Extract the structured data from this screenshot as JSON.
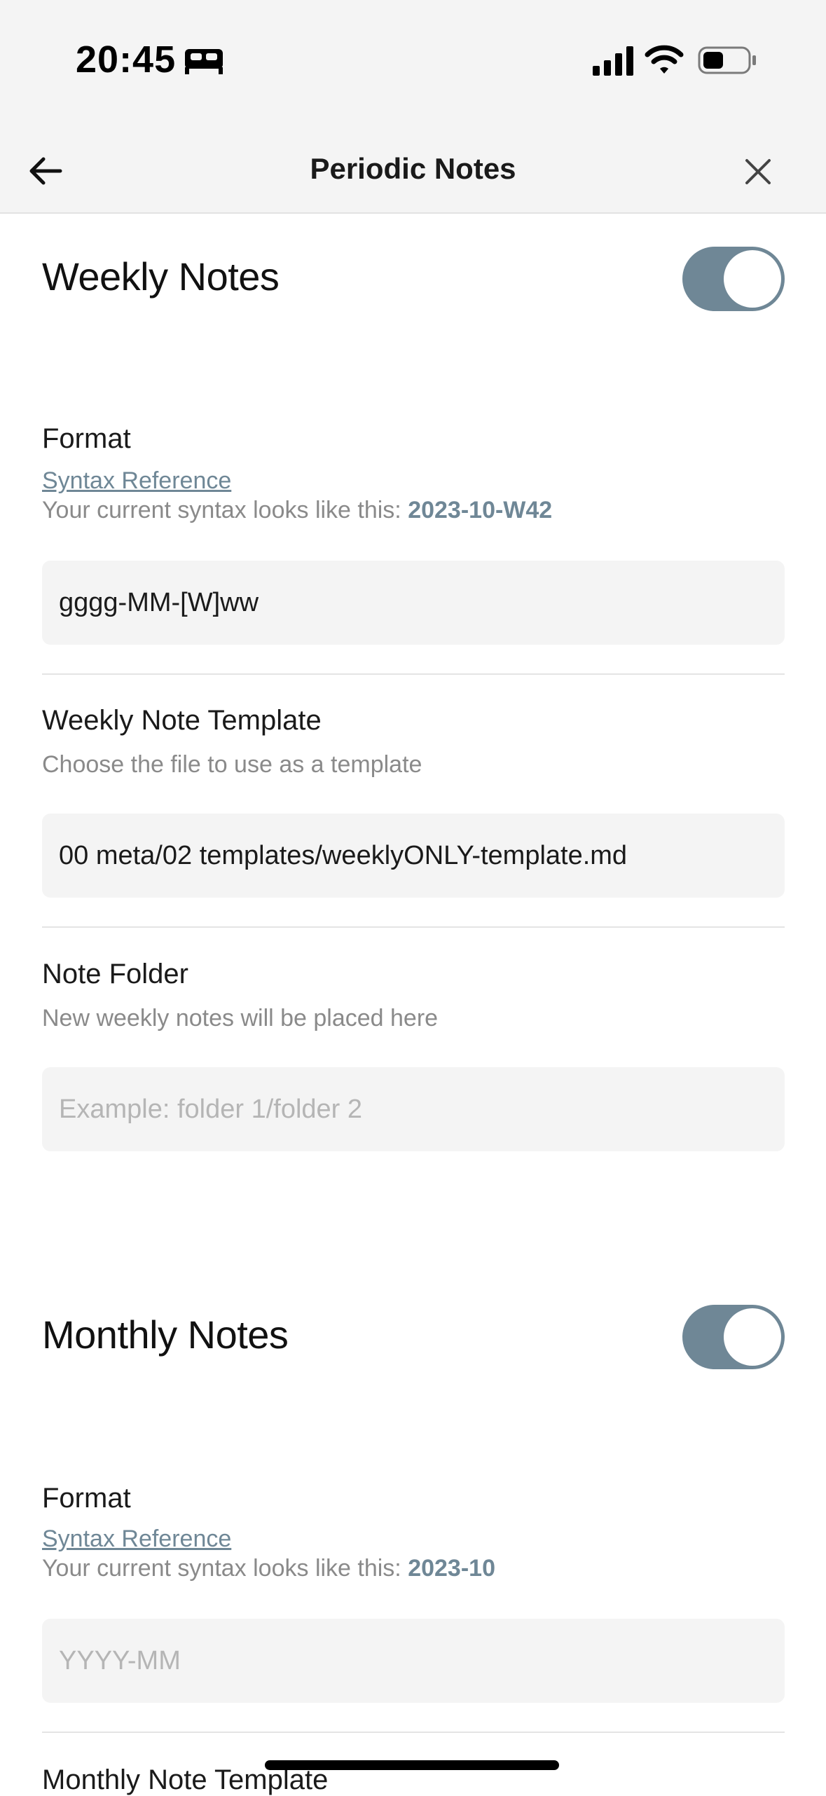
{
  "status_bar": {
    "time": "20:45",
    "icons": [
      "bed-icon",
      "signal-icon",
      "wifi-icon",
      "battery-icon"
    ]
  },
  "nav": {
    "title": "Periodic Notes",
    "back_icon": "arrow-left",
    "close_icon": "x-close"
  },
  "weekly": {
    "heading": "Weekly Notes",
    "enabled": true,
    "format": {
      "label": "Format",
      "link": "Syntax Reference",
      "desc_prefix": "Your current syntax looks like this: ",
      "desc_value": "2023-10-W42",
      "value": "gggg-MM-[W]ww"
    },
    "template": {
      "label": "Weekly Note Template",
      "desc": "Choose the file to use as a template",
      "value": "00 meta/02 templates/weeklyONLY-template.md"
    },
    "folder": {
      "label": "Note Folder",
      "desc": "New weekly notes will be placed here",
      "placeholder": "Example: folder 1/folder 2"
    }
  },
  "monthly": {
    "heading": "Monthly Notes",
    "enabled": true,
    "format": {
      "label": "Format",
      "link": "Syntax Reference",
      "desc_prefix": "Your current syntax looks like this: ",
      "desc_value": "2023-10",
      "placeholder": "YYYY-MM"
    },
    "template": {
      "label": "Monthly Note Template"
    }
  },
  "colors": {
    "accent": "#6f8796",
    "field_bg": "#f4f4f4",
    "header_bg": "#f4f4f4"
  }
}
